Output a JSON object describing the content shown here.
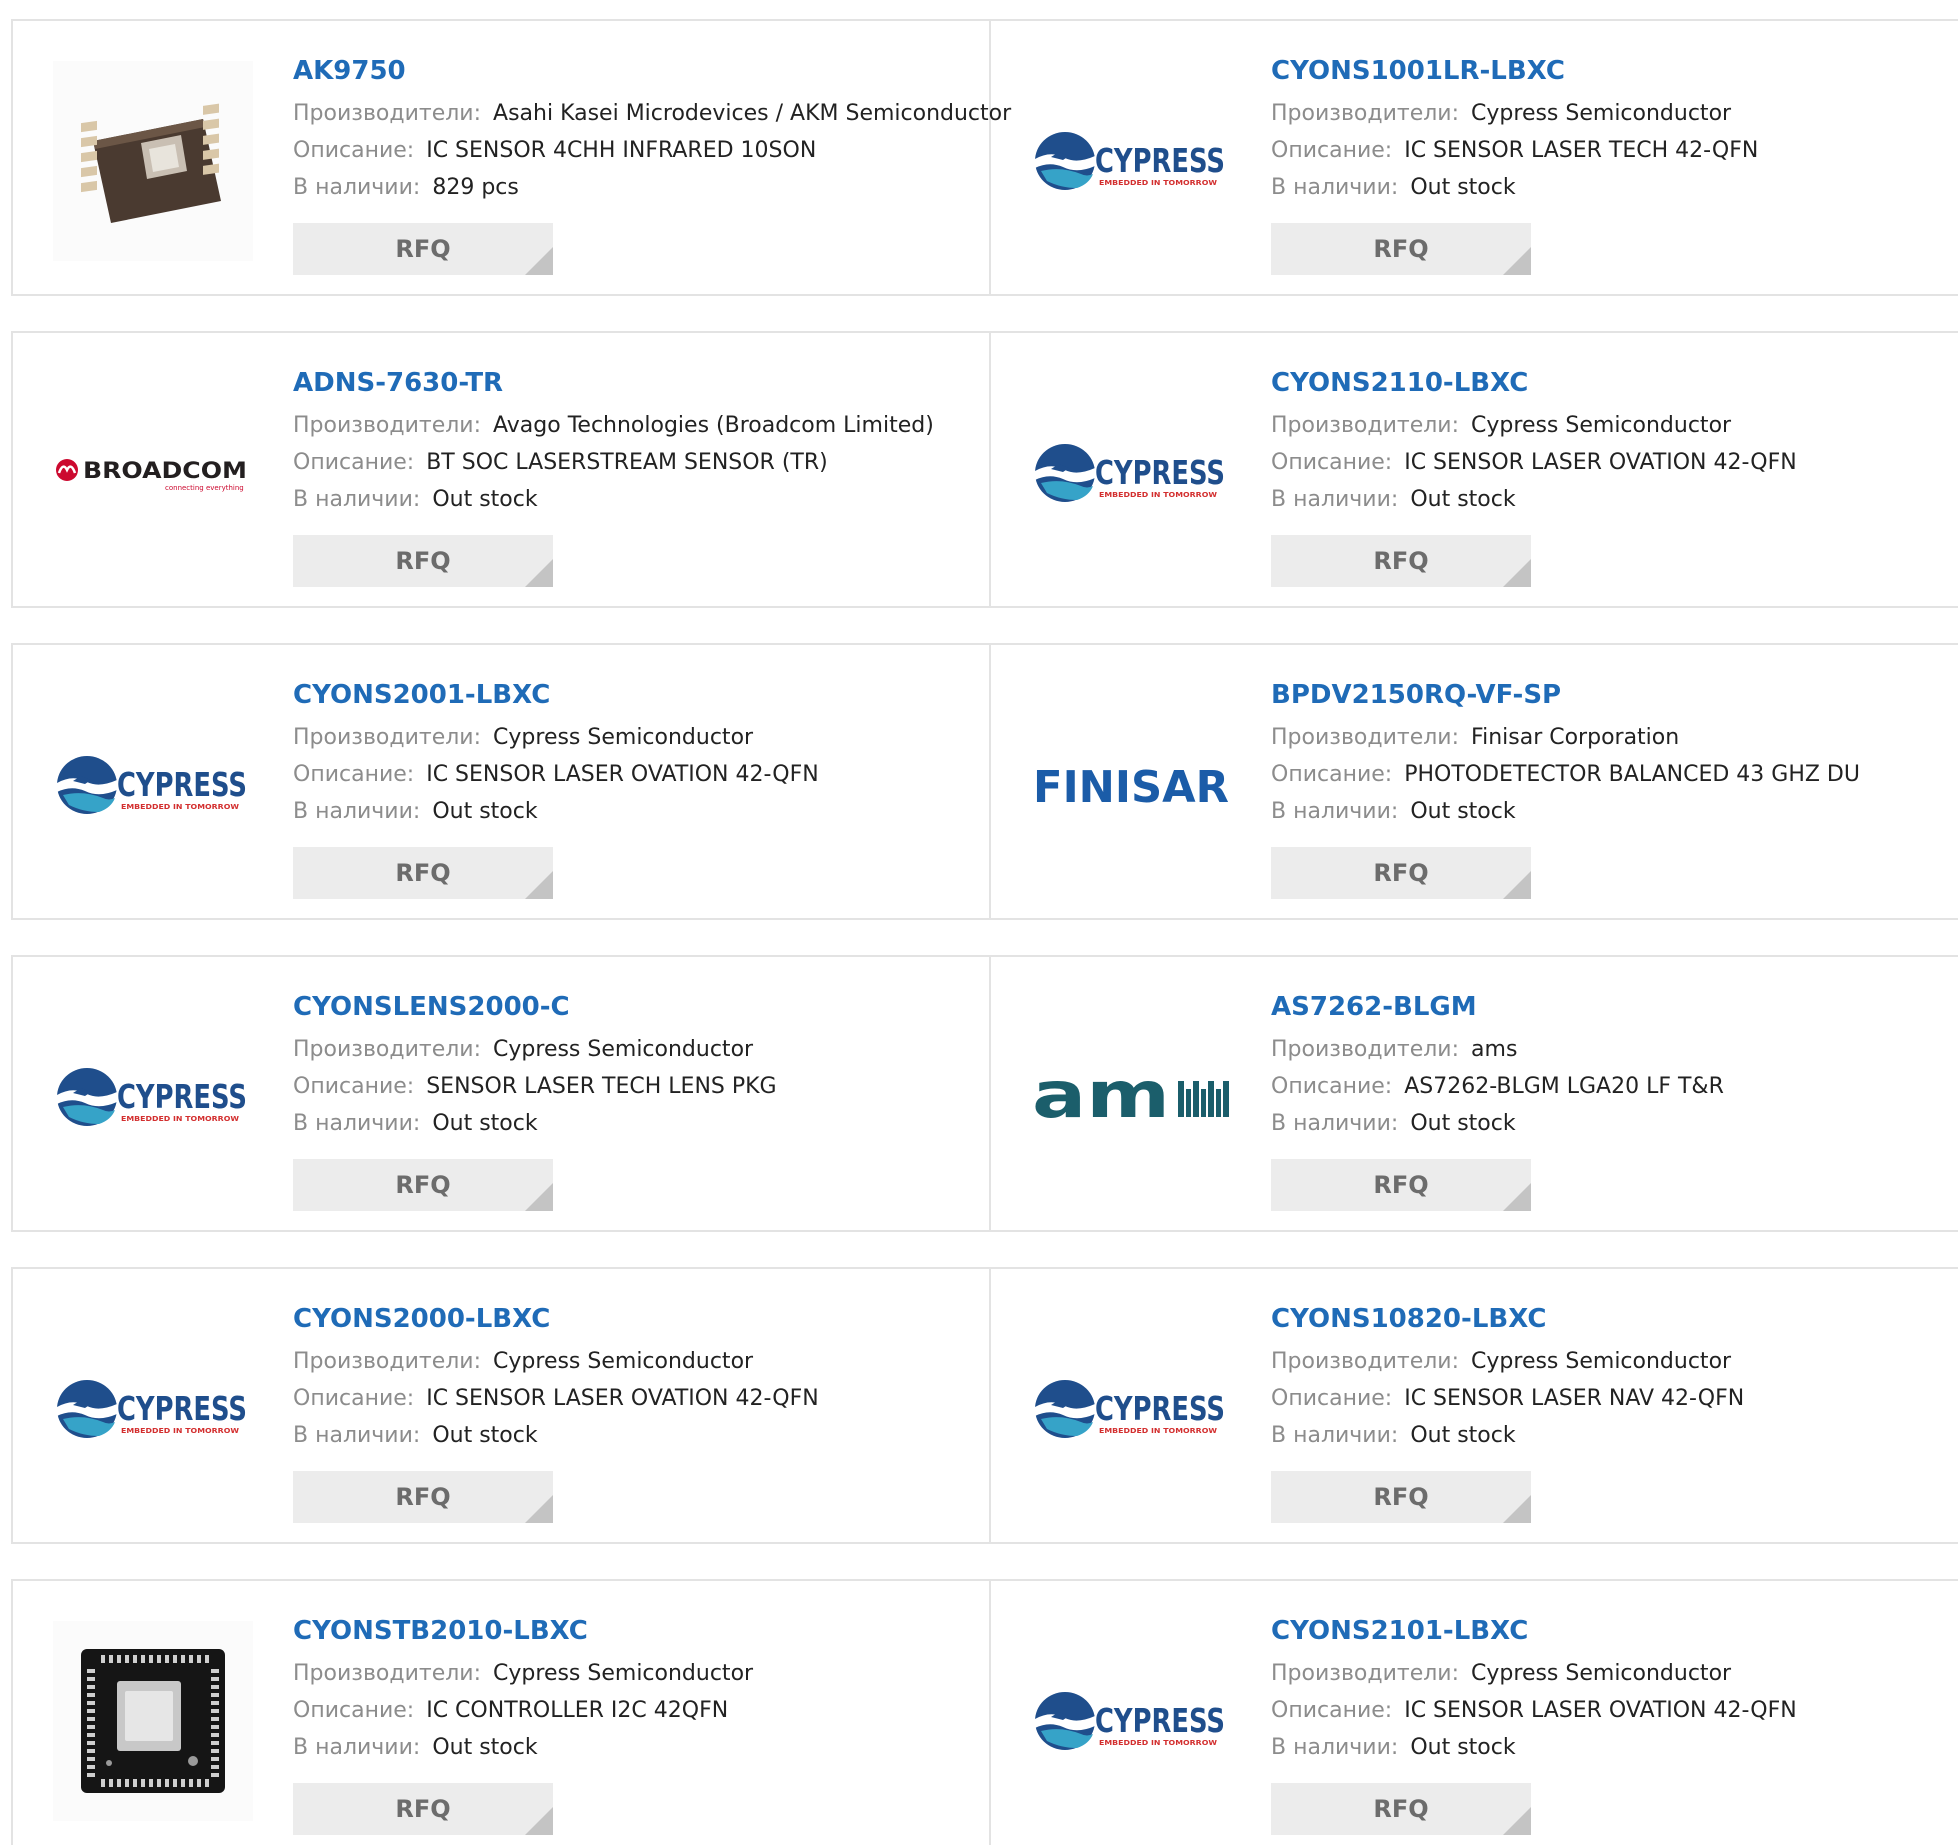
{
  "labels": {
    "manufacturer": "Производители:",
    "description": "Описание:",
    "stock": "В наличии:",
    "rfq": "RFQ"
  },
  "colors": {
    "link": "#1f6bb7",
    "cypress_blue": "#1f4e8c",
    "cypress_teal": "#36a3c8",
    "cypress_red": "#d32f2f",
    "broadcom_red": "#cc092f",
    "finisar_blue": "#1b5ca8",
    "ams_teal": "#1b5e6b",
    "rfq_bg": "#ececec",
    "border": "#e3e3e3"
  },
  "logos": {
    "cypress": {
      "word": "CYPRESS",
      "tagline": "EMBEDDED IN TOMORROW"
    },
    "broadcom": {
      "word": "BROADCOM",
      "tagline": "connecting everything"
    },
    "finisar": {
      "word": "FINISAR"
    },
    "ams": {
      "word": "am"
    }
  },
  "products": [
    {
      "part": "AK9750",
      "manufacturer": "Asahi Kasei Microdevices / AKM Semiconductor",
      "description": "IC SENSOR 4CHH INFRARED 10SON",
      "stock": "829 pcs",
      "image": "sensor-chip-photo"
    },
    {
      "part": "CYONS1001LR-LBXC",
      "manufacturer": "Cypress Semiconductor",
      "description": "IC SENSOR LASER TECH 42-QFN",
      "stock": "Out stock",
      "image": "cypress-logo"
    },
    {
      "part": "ADNS-7630-TR",
      "manufacturer": "Avago Technologies (Broadcom Limited)",
      "description": "BT SOC LASERSTREAM SENSOR (TR)",
      "stock": "Out stock",
      "image": "broadcom-logo"
    },
    {
      "part": "CYONS2110-LBXC",
      "manufacturer": "Cypress Semiconductor",
      "description": "IC SENSOR LASER OVATION 42-QFN",
      "stock": "Out stock",
      "image": "cypress-logo"
    },
    {
      "part": "CYONS2001-LBXC",
      "manufacturer": "Cypress Semiconductor",
      "description": "IC SENSOR LASER OVATION 42-QFN",
      "stock": "Out stock",
      "image": "cypress-logo"
    },
    {
      "part": "BPDV2150RQ-VF-SP",
      "manufacturer": "Finisar Corporation",
      "description": "PHOTODETECTOR BALANCED 43 GHZ DU",
      "stock": "Out stock",
      "image": "finisar-logo"
    },
    {
      "part": "CYONSLENS2000-C",
      "manufacturer": "Cypress Semiconductor",
      "description": "SENSOR LASER TECH LENS PKG",
      "stock": "Out stock",
      "image": "cypress-logo"
    },
    {
      "part": "AS7262-BLGM",
      "manufacturer": "ams",
      "description": "AS7262-BLGM LGA20 LF T&R",
      "stock": "Out stock",
      "image": "ams-logo"
    },
    {
      "part": "CYONS2000-LBXC",
      "manufacturer": "Cypress Semiconductor",
      "description": "IC SENSOR LASER OVATION 42-QFN",
      "stock": "Out stock",
      "image": "cypress-logo"
    },
    {
      "part": "CYONS10820-LBXC",
      "manufacturer": "Cypress Semiconductor",
      "description": "IC SENSOR LASER NAV 42-QFN",
      "stock": "Out stock",
      "image": "cypress-logo"
    },
    {
      "part": "CYONSTB2010-LBXC",
      "manufacturer": "Cypress Semiconductor",
      "description": "IC CONTROLLER I2C 42QFN",
      "stock": "Out stock",
      "image": "qfn-module-photo"
    },
    {
      "part": "CYONS2101-LBXC",
      "manufacturer": "Cypress Semiconductor",
      "description": "IC SENSOR LASER OVATION 42-QFN",
      "stock": "Out stock",
      "image": "cypress-logo"
    }
  ]
}
